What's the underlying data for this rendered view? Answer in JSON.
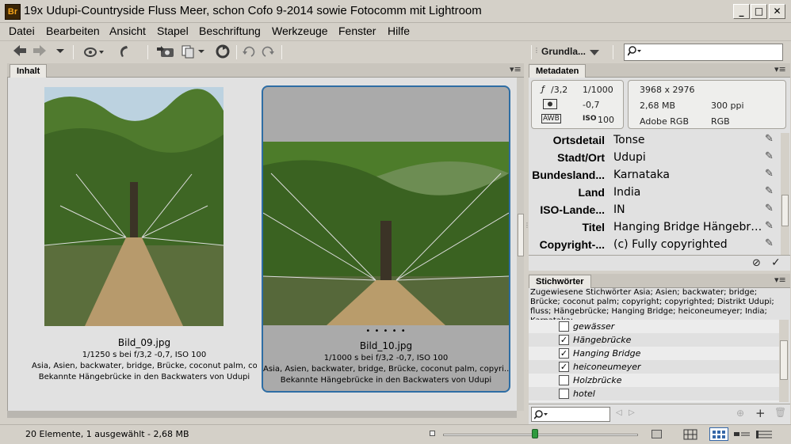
{
  "window": {
    "app_badge": "Br",
    "title": "19x Udupi-Countryside Fluss Meer, schon Cofo 9-2014 sowie Fotocomm mit Lightroom",
    "minimize": "_",
    "maximize": "□",
    "close": "✕"
  },
  "menu": [
    "Datei",
    "Bearbeiten",
    "Ansicht",
    "Stapel",
    "Beschriftung",
    "Werkzeuge",
    "Fenster",
    "Hilfe"
  ],
  "toolbar": {
    "workspace": "Grundla...",
    "search_placeholder": ""
  },
  "content_panel": {
    "tab": "Inhalt",
    "items": [
      {
        "filename": "Bild_09.jpg",
        "exif": "1/1250 s bei f/3,2 -0,7, ISO 100",
        "keywords": "Asia, Asien, backwater, bridge, Brücke, coconut palm, copyri...",
        "description": "Bekannte Hängebrücke in den Backwaters von Udupi",
        "selected": false
      },
      {
        "filename": "Bild_10.jpg",
        "exif": "1/1000 s bei f/3,2 -0,7, ISO 100",
        "keywords": "Asia, Asien, backwater, bridge, Brücke, coconut palm, copyri...",
        "description": "Bekannte Hängebrücke in den Backwaters von Udupi",
        "rating_dots": "• • • • •",
        "selected": true
      }
    ]
  },
  "metadata_panel": {
    "tab": "Metadaten",
    "camera": {
      "aperture": "3,2",
      "shutter": "1/1000",
      "exposure": "-0,7",
      "awb": "AWB",
      "iso_label": "ISO",
      "iso": "100",
      "dimensions": "3968 x 2976",
      "filesize": "2,68 MB",
      "ppi": "300 ppi",
      "profile": "Adobe RGB",
      "mode": "RGB"
    },
    "fields": [
      {
        "label": "Ortsdetail",
        "value": "Tonse"
      },
      {
        "label": "Stadt/Ort",
        "value": "Udupi"
      },
      {
        "label": "Bundesland...",
        "value": "Karnataka"
      },
      {
        "label": "Land",
        "value": "India"
      },
      {
        "label": "ISO-Lande...",
        "value": "IN"
      },
      {
        "label": "Titel",
        "value": "Hanging Bridge Hängebrück..."
      },
      {
        "label": "Copyright-...",
        "value": "(c) Fully copyrighted"
      }
    ]
  },
  "keywords_panel": {
    "tab": "Stichwörter",
    "assigned": "Zugewiesene Stichwörter Asia; Asien; backwater; bridge; Brücke; coconut palm; copyright; copyrighted; Distrikt Udupi; fluss; Hängebrücke; Hanging Bridge; heiconeumeyer; India; Karnataka;",
    "items": [
      {
        "label": "gewässer",
        "checked": false
      },
      {
        "label": "Hängebrücke",
        "checked": true
      },
      {
        "label": "Hanging Bridge",
        "checked": true
      },
      {
        "label": "heiconeumeyer",
        "checked": true
      },
      {
        "label": "Holzbrücke",
        "checked": false
      },
      {
        "label": "hotel",
        "checked": false
      }
    ]
  },
  "statusbar": {
    "text": "20 Elemente, 1 ausgewählt - 2,68 MB",
    "zoom_fraction": 0.47
  },
  "colors": {
    "selection_border": "#2e6da4",
    "selected_bg": "#aaaaaa",
    "zoom_thumb": "#2f9a3e"
  }
}
